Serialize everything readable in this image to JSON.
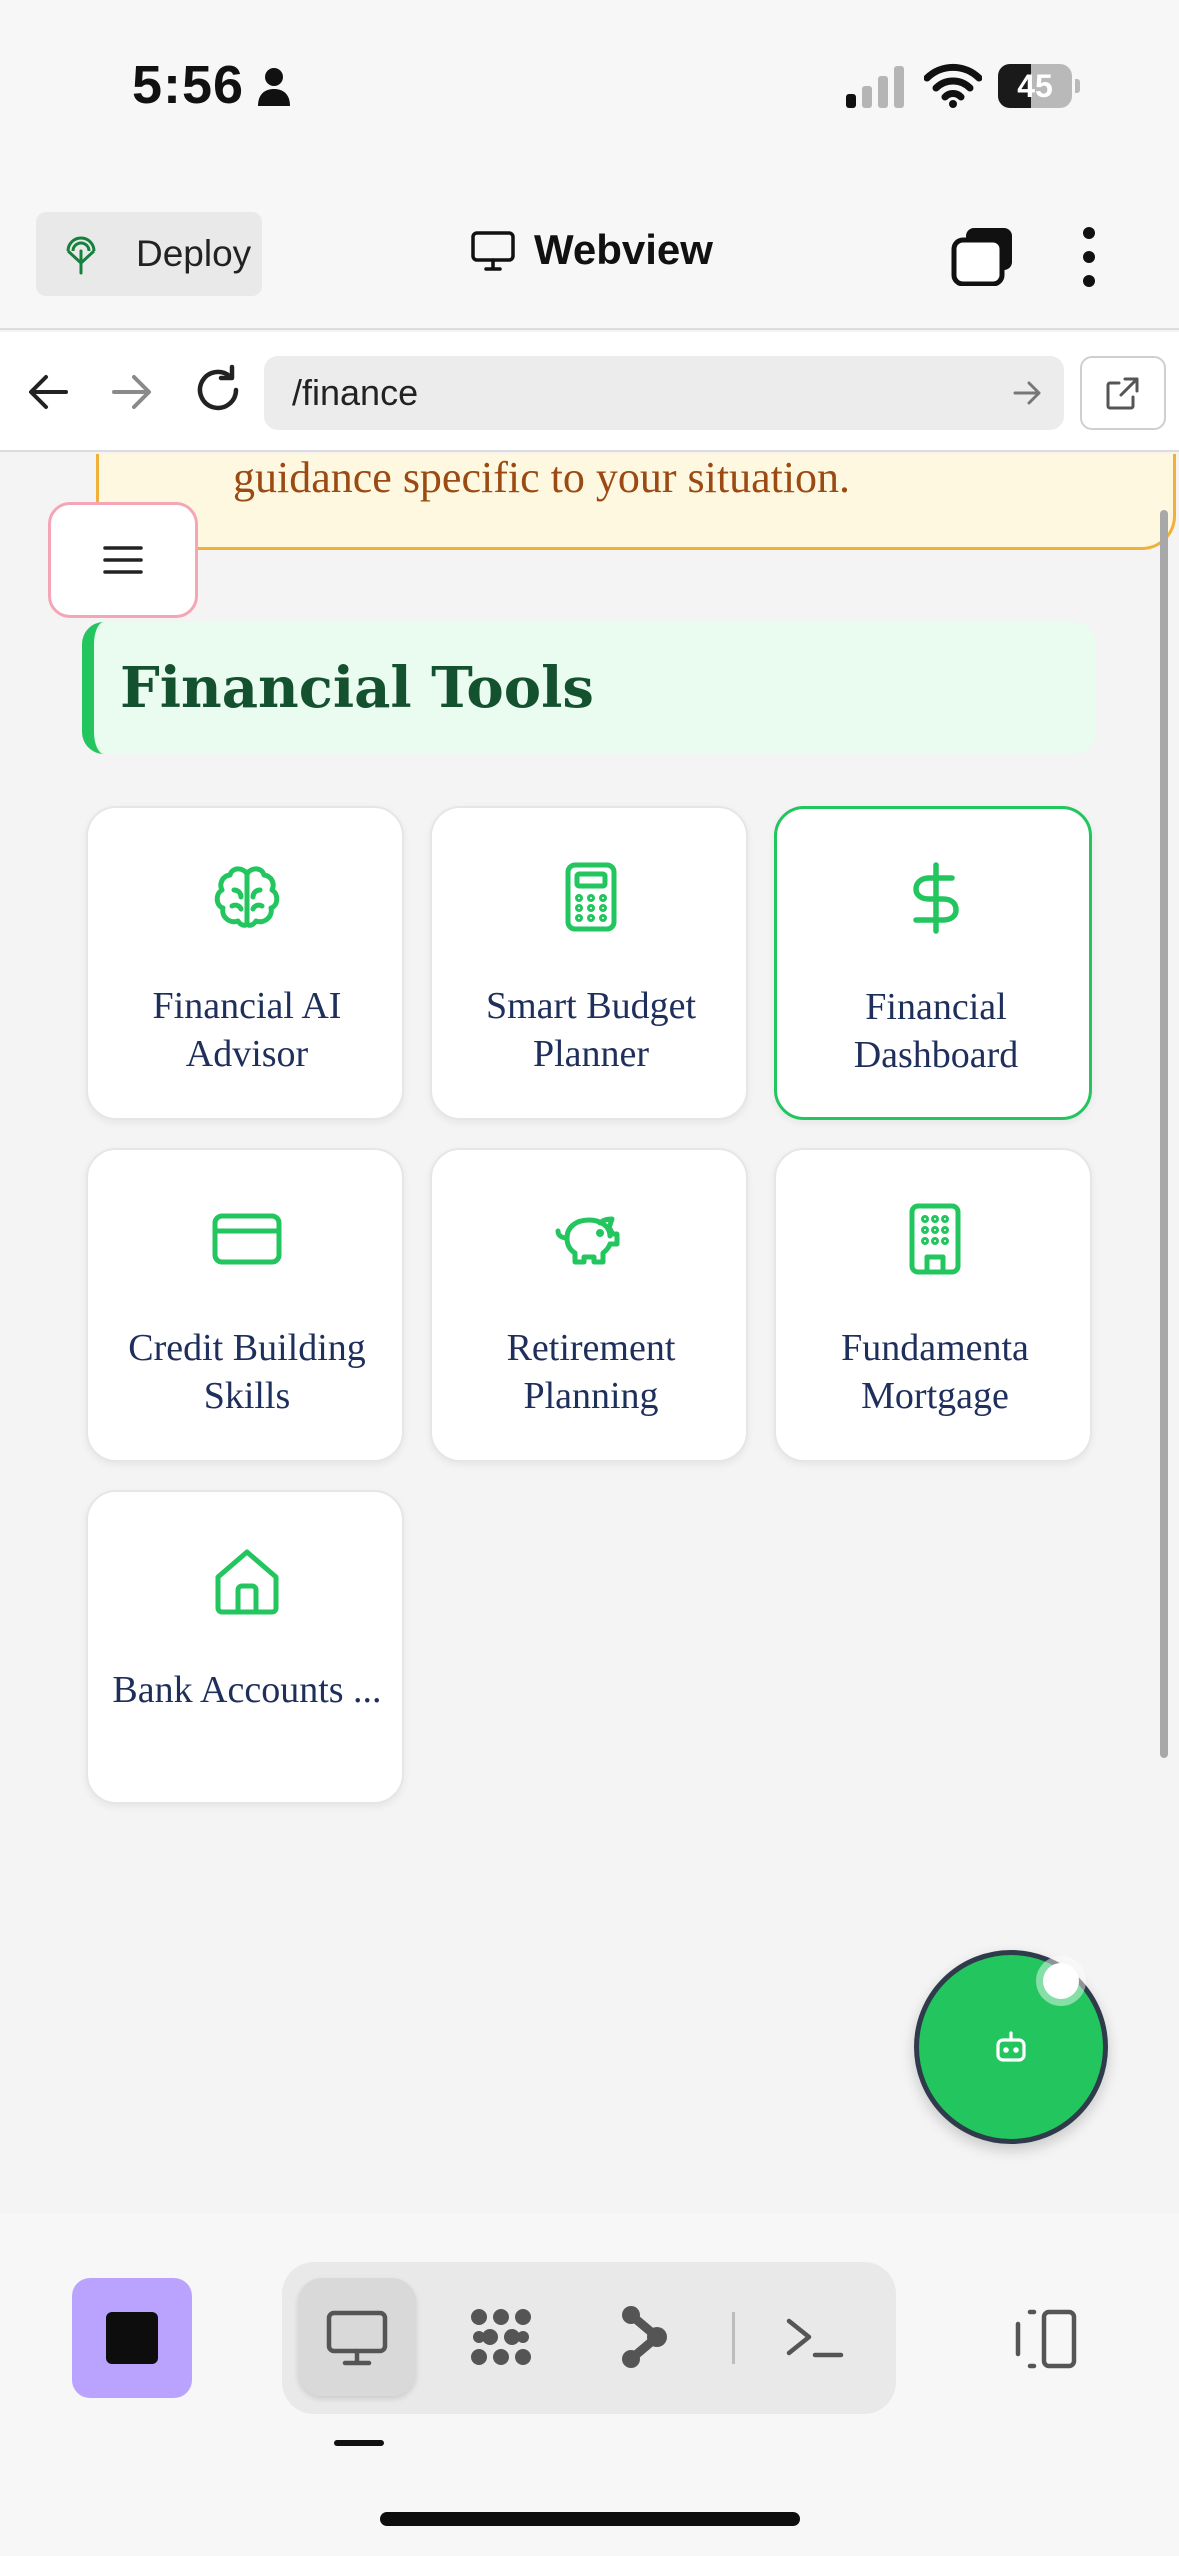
{
  "status_bar": {
    "time": "5:56",
    "battery_level": "45",
    "battery_fraction": 0.45
  },
  "app_bar": {
    "deploy_label": "Deploy",
    "title": "Webview"
  },
  "browser": {
    "url": "/finance"
  },
  "page": {
    "alert_text": "guidance specific to your situation.",
    "section_title": "Financial Tools",
    "tools": [
      {
        "label": "Financial AI Advisor",
        "icon": "brain-icon",
        "active": false
      },
      {
        "label": "Smart Budget Planner",
        "icon": "calculator-icon",
        "active": false
      },
      {
        "label": "Financial Dashboard",
        "icon": "dollar-icon",
        "active": true
      },
      {
        "label": "Credit Building Skills",
        "icon": "credit-card-icon",
        "active": false
      },
      {
        "label": "Retirement Planning",
        "icon": "piggy-bank-icon",
        "active": false
      },
      {
        "label": "Fundamenta Mortgage",
        "icon": "building-icon",
        "active": false
      },
      {
        "label": "Bank Accounts ...",
        "icon": "home-icon",
        "active": false
      }
    ]
  },
  "dock": {
    "items": [
      "webview-icon",
      "agents-icon",
      "git-icon",
      "terminal-icon"
    ],
    "selected": "webview-icon"
  },
  "colors": {
    "accent_green": "#22c55e",
    "heading_green": "#14522f",
    "label_navy": "#1f2f5c",
    "alert_text": "#9a4a12",
    "alert_border": "#f0b13a",
    "stop_button": "#b9a3ff",
    "menu_border": "#f5a6b6"
  }
}
